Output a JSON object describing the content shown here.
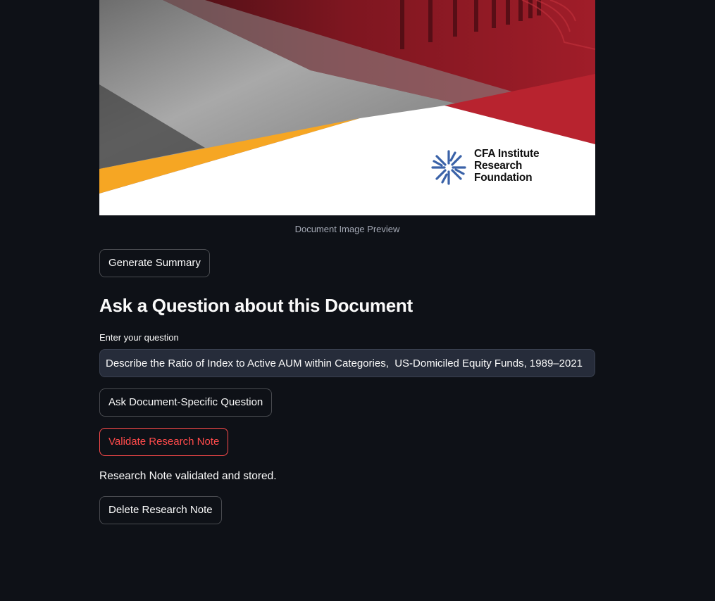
{
  "document_preview": {
    "logo_text_lines": [
      "CFA Institute",
      "Research",
      "Foundation"
    ],
    "caption": "Document Image Preview",
    "colors": {
      "red": "#9c1a26",
      "bright_red": "#b8232f",
      "orange": "#f6a623",
      "white": "#ffffff",
      "logo_blue": "#3a62a8"
    }
  },
  "actions": {
    "generate_summary_label": "Generate Summary"
  },
  "question_section": {
    "title": "Ask a Question about this Document",
    "input_label": "Enter your question",
    "input_value": "Describe the Ratio of Index to Active AUM within Categories,  US-Domiciled Equity Funds, 1989–2021",
    "ask_button_label": "Ask Document-Specific Question",
    "validate_button_label": "Validate Research Note",
    "status_message": "Research Note validated and stored.",
    "delete_button_label": "Delete Research Note"
  },
  "theme": {
    "background": "#0e1117",
    "text": "#fafafa",
    "danger": "#ff4b4b",
    "input_background": "#262c3a"
  }
}
